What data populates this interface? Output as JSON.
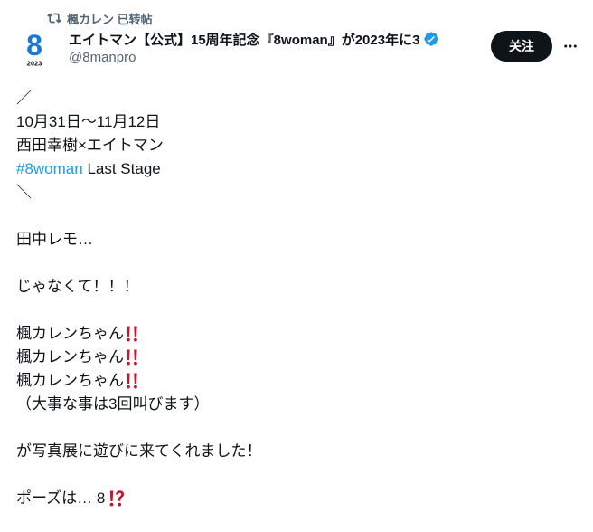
{
  "retweet": {
    "icon": "retweet-icon",
    "text": "楓カレン 已转帖"
  },
  "author": {
    "avatar_label": "8",
    "avatar_year": "2023",
    "display_name": "エイトマン【公式】15周年記念『8woman』が2023年に3",
    "verified_icon": "verified-badge-icon",
    "handle": "@8manpro"
  },
  "actions": {
    "follow_label": "关注",
    "more_icon": "more-dots-icon"
  },
  "tweet": {
    "l1": "／",
    "l2": "10月31日～11月12日",
    "l3": "西田幸樹×エイトマン",
    "l4_hashtag": "#8woman",
    "l4_text": " Last Stage",
    "l5": "＼",
    "l7": "田中レモ…",
    "l9": "じゃなくて！！！",
    "l11": "楓カレンちゃん",
    "l12": "楓カレンちゃん",
    "l13": "楓カレンちゃん",
    "l14": "（大事な事は3回叫びます）",
    "l16": "が写真展に遊びに来てくれました！",
    "l18": "ポーズは… 8"
  },
  "colors": {
    "text": "#0f1419",
    "secondary": "#536471",
    "hashtag": "#1d9bf0",
    "verified": "#1d9bf0",
    "follow_bg": "#0f1419",
    "emoji_red": "#be1931",
    "avatar_blue": "#1878d4"
  }
}
